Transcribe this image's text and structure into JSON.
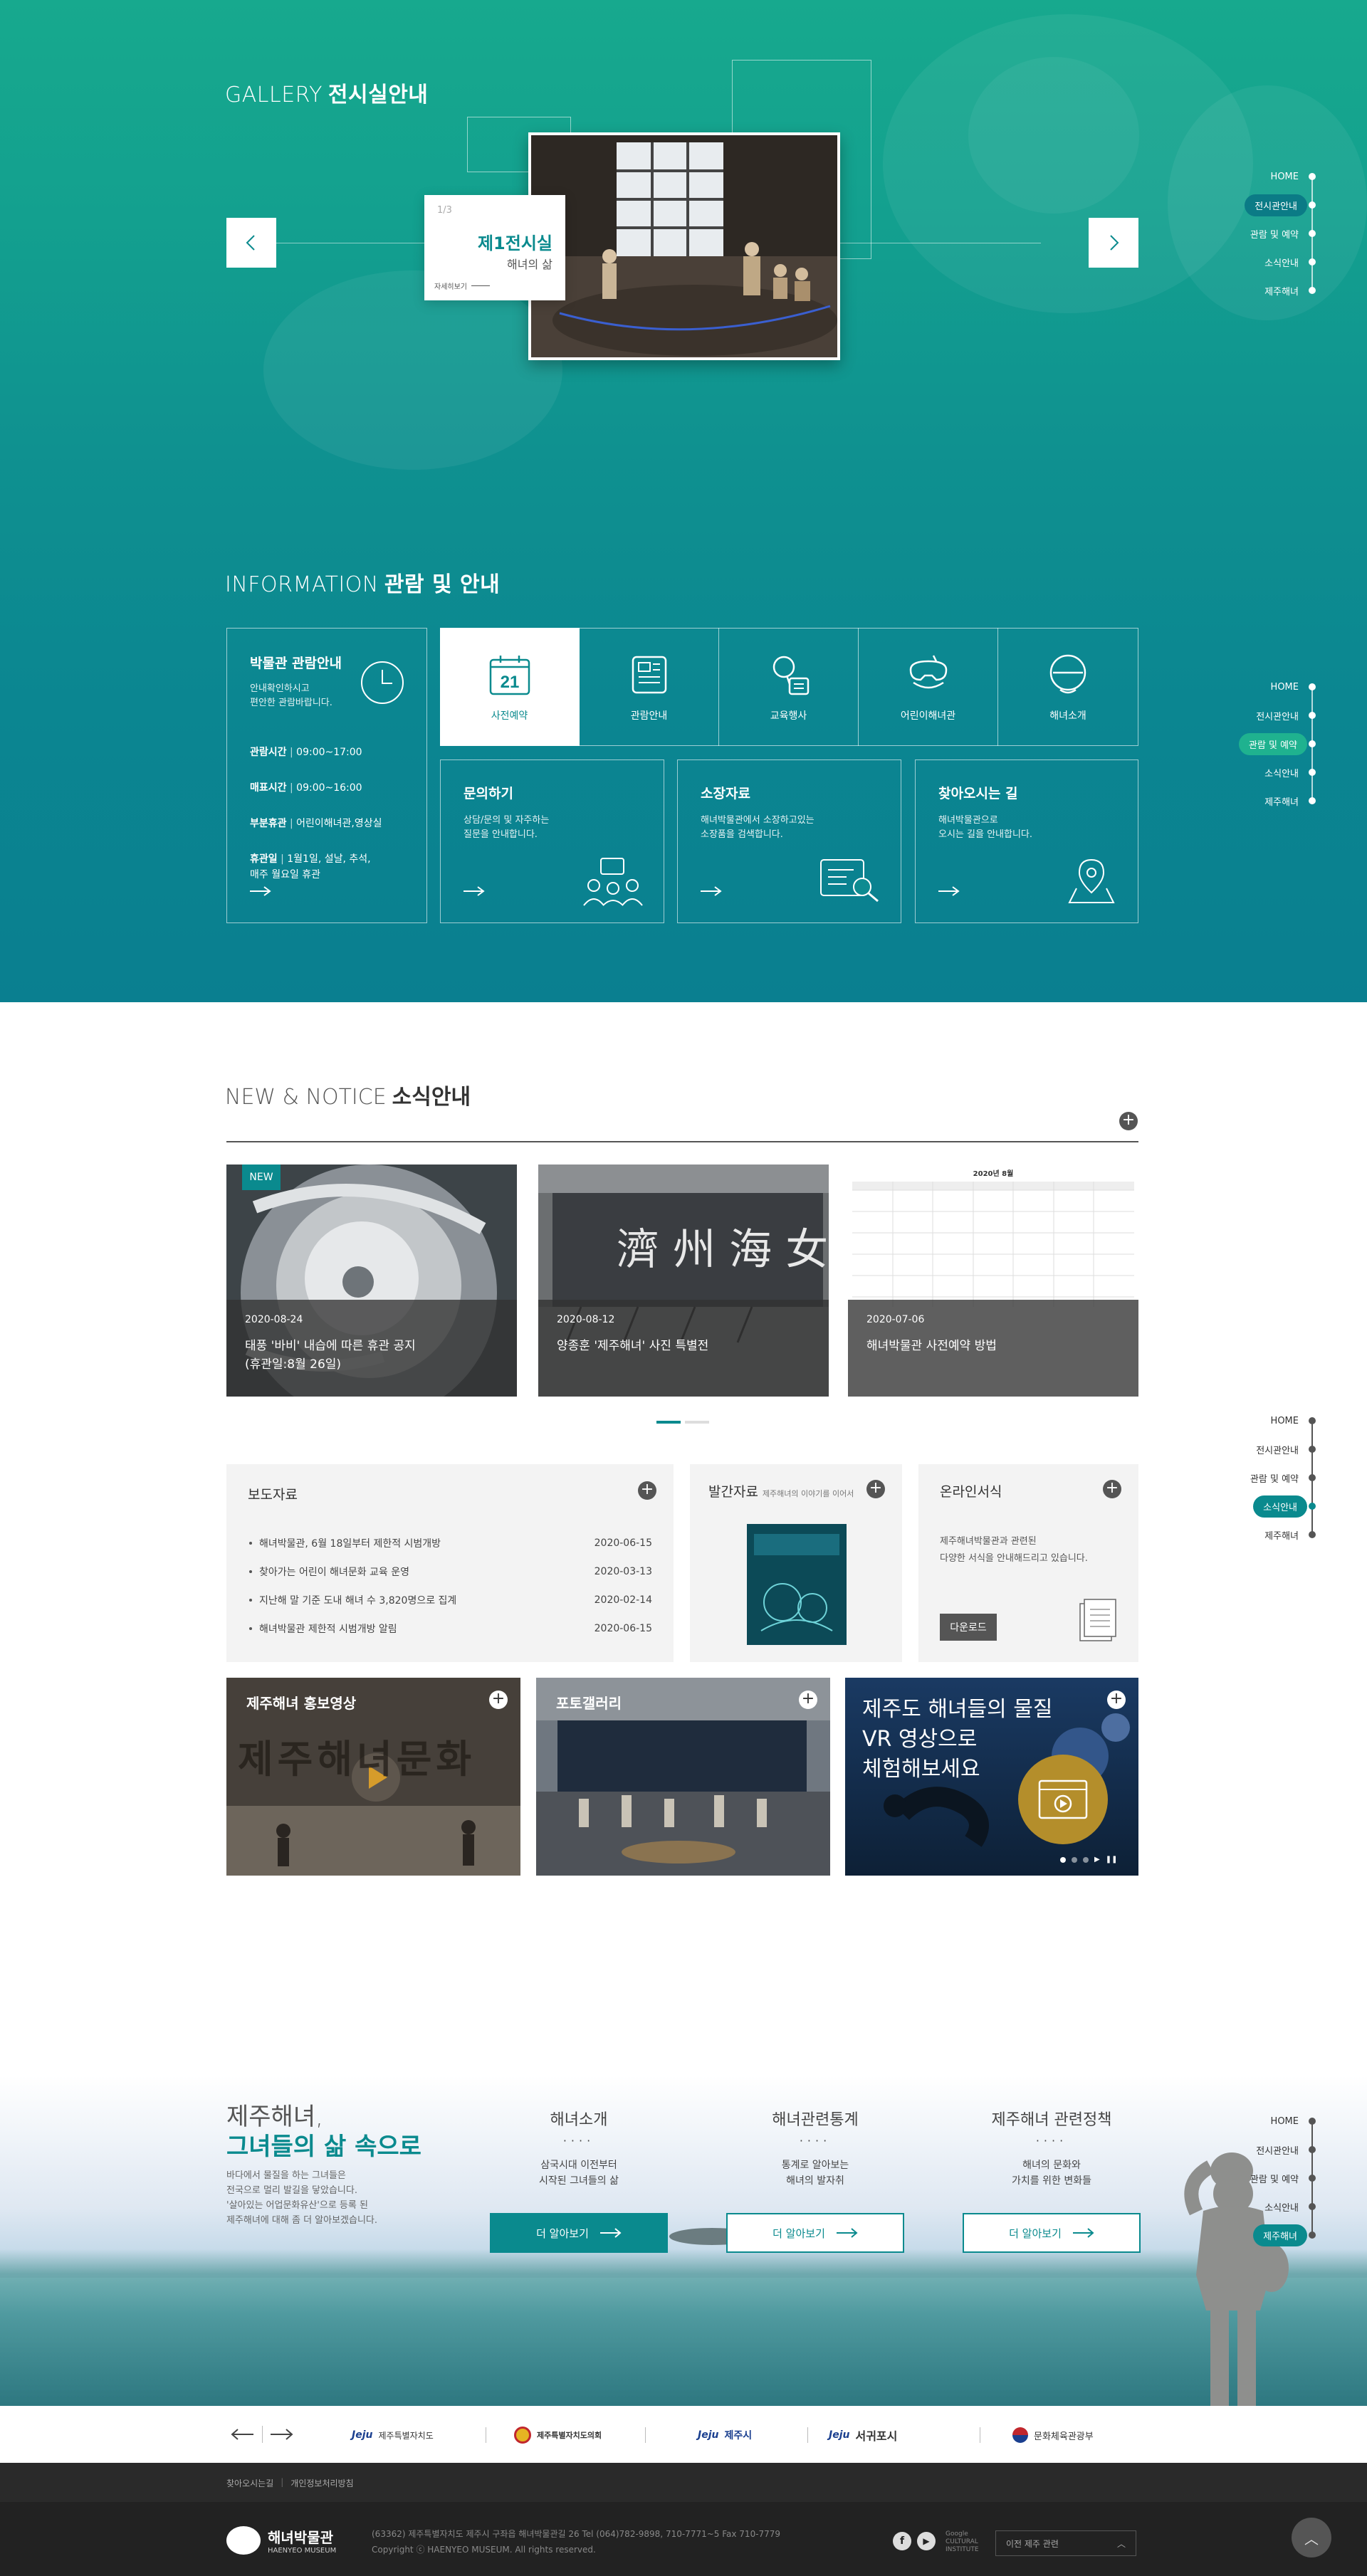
{
  "gallery": {
    "title_en": "GALLERY",
    "title_ko": "전시실안내",
    "counter": "1/3",
    "room_name": "제1전시실",
    "room_sub": "해녀의 삶",
    "detail_link": "자세히보기"
  },
  "side_nav": {
    "items": [
      "HOME",
      "전시관안내",
      "관람 및 예약",
      "소식안내",
      "제주해녀"
    ]
  },
  "information": {
    "title_en": "INFORMATION",
    "title_ko": "관람 및 안내",
    "hours_box": {
      "title": "박물관 관람안내",
      "desc_1": "안내확인하시고",
      "desc_2": "편안한 관람바랍니다.",
      "rows": [
        {
          "label": "관람시간",
          "value": "09:00~17:00"
        },
        {
          "label": "매표시간",
          "value": "09:00~16:00"
        },
        {
          "label": "부분휴관",
          "value": "어린이해녀관,영상실"
        },
        {
          "label": "휴관일",
          "value": "1월1일, 설날, 추석,"
        }
      ],
      "closed_extra": "매주 월요일 휴관"
    },
    "quick_links": [
      {
        "label": "사전예약",
        "icon": "calendar-icon",
        "badge": "21"
      },
      {
        "label": "관람안내",
        "icon": "document-icon"
      },
      {
        "label": "교육행사",
        "icon": "education-icon"
      },
      {
        "label": "어린이해녀관",
        "icon": "diving-mask-icon"
      },
      {
        "label": "해녀소개",
        "icon": "diver-icon"
      }
    ],
    "cards": [
      {
        "title": "문의하기",
        "line1": "상담/문의 및 자주하는",
        "line2": "질문을 안내합니다."
      },
      {
        "title": "소장자료",
        "line1": "해녀박물관에서 소장하고있는",
        "line2": "소장품을 검색합니다."
      },
      {
        "title": "찾아오시는 길",
        "line1": "해녀박물관으로",
        "line2": "오시는 길을 안내합니다."
      }
    ]
  },
  "news": {
    "title_en": "NEW & NOTICE",
    "title_ko": "소식안내",
    "new_badge": "NEW",
    "cards": [
      {
        "date": "2020-08-24",
        "title_1": "태풍 '바비' 내습에 따른 휴관 공지",
        "title_2": "(휴관일:8월 26일)"
      },
      {
        "date": "2020-08-12",
        "title_1": "양종훈 '제주해녀' 사진 특별전",
        "title_2": ""
      },
      {
        "date": "2020-07-06",
        "title_1": "해녀박물관 사전예약 방법",
        "title_2": ""
      }
    ],
    "calendar_title": "2020년 8월"
  },
  "press": {
    "title": "보도자료",
    "items": [
      {
        "text": "해녀박물관, 6월 18일부터 제한적 시범개방",
        "date": "2020-06-15"
      },
      {
        "text": "찾아가는 어린이 해녀문화 교육 운영",
        "date": "2020-03-13"
      },
      {
        "text": "지난해 말 기준 도내 해녀 수 3,820명으로 집계",
        "date": "2020-02-14"
      },
      {
        "text": "해녀박물관 제한적 시범개방 알림",
        "date": "2020-06-15"
      }
    ]
  },
  "publication": {
    "title": "발간자료",
    "subtitle": "제주해녀의 이야기를 이어서"
  },
  "forms": {
    "title": "온라인서식",
    "line1": "제주해녀박물관과 관련된",
    "line2": "다양한 서식을 안내해드리고 있습니다.",
    "button": "다운로드"
  },
  "media": {
    "video_label": "제주해녀 홍보영상",
    "video_overlay": "제주해녀문화",
    "photo_label": "포토갤러리",
    "vr_1": "제주도 해녀들의 물질",
    "vr_2": "VR 영상으로",
    "vr_3": "체험해보세요"
  },
  "haenyeo": {
    "title_1": "제주해녀,",
    "title_2": "그녀들의 삶 속으로",
    "desc": [
      "바다에서 물질을 하는 그녀들은",
      "전국으로 멀리 발길을 닿았습니다.",
      "'살아있는 어업문화유산'으로 등록 된",
      "제주해녀에 대해 좀 더 알아보겠습니다."
    ],
    "columns": [
      {
        "title": "해녀소개",
        "line1": "삼국시대 이전부터",
        "line2": "시작된 그녀들의 삶",
        "button": "더 알아보기"
      },
      {
        "title": "해녀관련통계",
        "line1": "통계로 알아보는",
        "line2": "해녀의 발자취",
        "button": "더 알아보기"
      },
      {
        "title": "제주해녀 관련정책",
        "line1": "해녀의 문화와",
        "line2": "가치를 위한 변화들",
        "button": "더 알아보기"
      }
    ]
  },
  "partners": [
    {
      "name": "제주특별자치도"
    },
    {
      "name": "제주특별자치도의회"
    },
    {
      "name": "제주시"
    },
    {
      "name": "서귀포시"
    },
    {
      "name": "문화체육관광부"
    }
  ],
  "footer": {
    "link_1": "찾아오시는길",
    "link_2": "개인정보처리방침",
    "logo_ko": "해녀박물관",
    "logo_en": "HAENYEO MUSEUM",
    "address": "(63362) 제주특별자치도 제주시 구좌읍 해녀박물관길 26 Tel (064)782-9898, 710-7771~5 Fax 710-7779",
    "copyright": "Copyright ⓒ HAENYEO MUSEUM. All rights reserved.",
    "gci_1": "Google",
    "gci_2": "CULTURAL",
    "gci_3": "INSTITUTE",
    "family_site": "이전 제주 관련"
  },
  "colors": {
    "teal": "#0a8a8e",
    "teal_light": "#17a98e",
    "dark": "#222222"
  }
}
